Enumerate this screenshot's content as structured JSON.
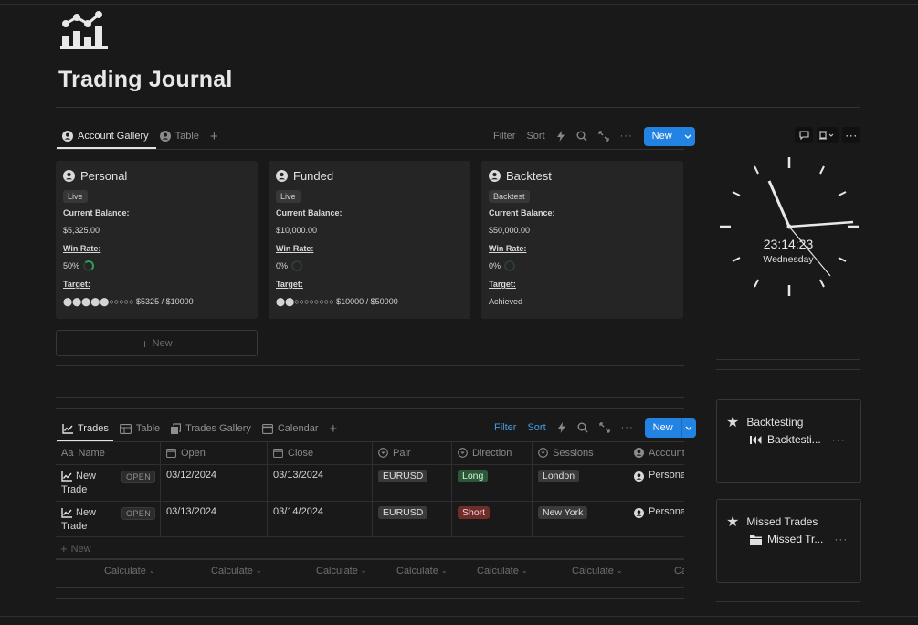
{
  "page": {
    "title": "Trading Journal",
    "icon": "chart-icon"
  },
  "account_db": {
    "tabs": [
      {
        "label": "Account Gallery",
        "icon": "person-icon",
        "active": true
      },
      {
        "label": "Table",
        "icon": "person-icon",
        "active": false
      }
    ],
    "toolbar": {
      "filter": "Filter",
      "sort": "Sort",
      "new": "New"
    },
    "cards": [
      {
        "name": "Personal",
        "tag": "Live",
        "balance_label": "Current Balance:",
        "balance": "$5,325.00",
        "winrate_label": "Win Rate:",
        "winrate": "50%",
        "target_label": "Target:",
        "target": "⬤⬤⬤⬤⬤○○○○○ $5325 / $10000"
      },
      {
        "name": "Funded",
        "tag": "Live",
        "balance_label": "Current Balance:",
        "balance": "$10,000.00",
        "winrate_label": "Win Rate:",
        "winrate": "0%",
        "target_label": "Target:",
        "target": "⬤⬤○○○○○○○○ $10000 / $50000"
      },
      {
        "name": "Backtest",
        "tag": "Backtest",
        "balance_label": "Current Balance:",
        "balance": "$50,000.00",
        "winrate_label": "Win Rate:",
        "winrate": "0%",
        "target_label": "Target:",
        "target": "Achieved"
      }
    ],
    "new_label": "New"
  },
  "clock": {
    "time": "23:14:23",
    "day": "Wednesday"
  },
  "trades_db": {
    "tabs": [
      {
        "label": "Trades",
        "icon": "chart-line-icon",
        "active": true
      },
      {
        "label": "Table",
        "icon": "table-icon",
        "active": false
      },
      {
        "label": "Trades Gallery",
        "icon": "gallery-icon",
        "active": false
      },
      {
        "label": "Calendar",
        "icon": "calendar-icon",
        "active": false
      }
    ],
    "toolbar": {
      "filter": "Filter",
      "sort": "Sort",
      "new": "New"
    },
    "columns": [
      "Name",
      "Open",
      "Close",
      "Pair",
      "Direction",
      "Sessions",
      "Account"
    ],
    "rows": [
      {
        "name": "New Trade",
        "status": "OPEN",
        "open": "03/12/2024",
        "close": "03/13/2024",
        "pair": "EURUSD",
        "direction": "Long",
        "session": "London",
        "account": "Personal"
      },
      {
        "name": "New Trade",
        "status": "OPEN",
        "open": "03/13/2024",
        "close": "03/14/2024",
        "pair": "EURUSD",
        "direction": "Short",
        "session": "New York",
        "account": "Personal"
      }
    ],
    "new_label": "New",
    "calculate": "Calculate",
    "calculate_cut": "Ca"
  },
  "sidebar": {
    "backtesting": {
      "title": "Backtesting",
      "item": "Backtesti..."
    },
    "missed": {
      "title": "Missed Trades",
      "item": "Missed Tr..."
    }
  }
}
